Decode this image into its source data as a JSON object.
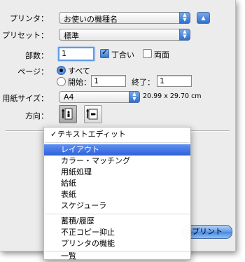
{
  "printer": {
    "label": "プリンタ：",
    "value": "お使いの機種名"
  },
  "preset": {
    "label": "プリセット：",
    "value": "標準"
  },
  "copies": {
    "label": "部数：",
    "value": "1",
    "collated_label": "丁合い",
    "collated": true,
    "duplex_label": "両面",
    "duplex": false
  },
  "pages": {
    "label": "ページ：",
    "all_label": "すべて",
    "from_label": "開始：",
    "from_value": "1",
    "to_label": "終了：",
    "to_value": "1",
    "selected": "all"
  },
  "paper_size": {
    "label": "用紙サイズ：",
    "value": "A4",
    "dimensions": "20.99 x 29.70 cm"
  },
  "orientation": {
    "label": "方向："
  },
  "print_button": "プリント",
  "menu": {
    "items": [
      {
        "label": "テキストエディット",
        "checked": true,
        "highlighted": false
      },
      {
        "label": "レイアウト",
        "checked": false,
        "highlighted": true
      },
      {
        "label": "カラー・マッチング",
        "checked": false,
        "highlighted": false
      },
      {
        "label": "用紙処理",
        "checked": false,
        "highlighted": false
      },
      {
        "label": "給紙",
        "checked": false,
        "highlighted": false
      },
      {
        "label": "表紙",
        "checked": false,
        "highlighted": false
      },
      {
        "label": "スケジューラ",
        "checked": false,
        "highlighted": false
      },
      {
        "label": "蓄積/履歴",
        "checked": false,
        "highlighted": false
      },
      {
        "label": "不正コピー抑止",
        "checked": false,
        "highlighted": false
      },
      {
        "label": "プリンタの機能",
        "checked": false,
        "highlighted": false
      },
      {
        "label": "一覧",
        "checked": false,
        "highlighted": false
      }
    ],
    "checkmark": "✓"
  },
  "icons": {
    "popup_arrows": "updown-arrows-icon",
    "disclosure": "triangle-up-icon",
    "portrait": "portrait-orientation-icon",
    "landscape": "landscape-orientation-icon"
  },
  "colors": {
    "accent": "#2e61d9",
    "dialog_bg": "#ececec"
  }
}
